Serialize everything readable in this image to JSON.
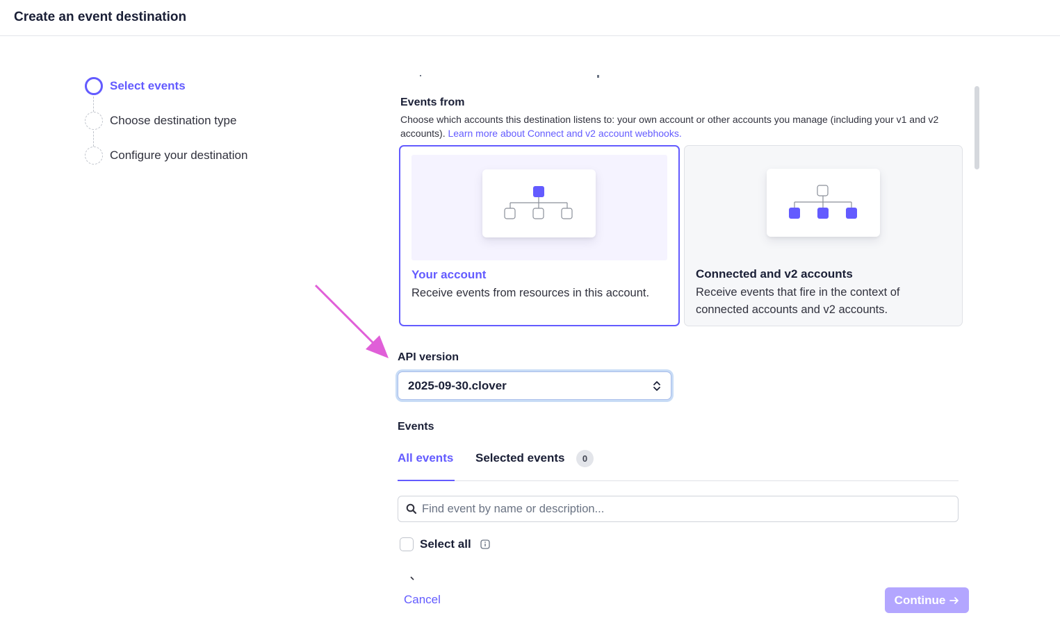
{
  "header": {
    "title": "Create an event destination"
  },
  "stepper": {
    "steps": [
      {
        "label": "Select events",
        "state": "active"
      },
      {
        "label": "Choose destination type",
        "state": "pending"
      },
      {
        "label": "Configure your destination",
        "state": "pending"
      }
    ]
  },
  "events_from": {
    "title": "Events from",
    "description": "Choose which accounts this destination listens to: your own account or other accounts you manage (including your v1 and v2 accounts).",
    "link_text": "Learn more about Connect and v2 account webhooks.",
    "options": [
      {
        "title": "Your account",
        "description": "Receive events from resources in this account.",
        "selected": true
      },
      {
        "title": "Connected and v2 accounts",
        "description": "Receive events that fire in the context of connected accounts and v2 accounts.",
        "selected": false
      }
    ]
  },
  "api_version": {
    "label": "API version",
    "value": "2025-09-30.clover"
  },
  "events": {
    "title": "Events",
    "tabs": [
      {
        "label": "All events",
        "active": true
      },
      {
        "label": "Selected events",
        "active": false,
        "count": "0"
      }
    ],
    "search": {
      "placeholder": "Find event by name or description...",
      "value": ""
    },
    "select_all": {
      "label": "Select all",
      "checked": false
    }
  },
  "footer": {
    "cancel_label": "Cancel",
    "continue_label": "Continue"
  },
  "colors": {
    "accent": "#635bff",
    "annotation_arrow": "#e05fd8",
    "continue_disabled": "#b3a6ff"
  },
  "icons": [
    "search-icon",
    "info-icon",
    "chevron-updown-icon",
    "arrow-right-icon"
  ]
}
